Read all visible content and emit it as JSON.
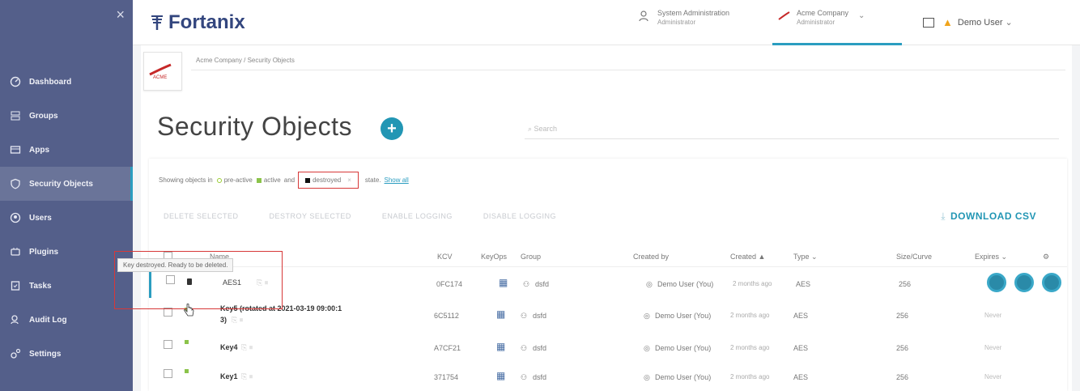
{
  "app": {
    "brand": "Fortanix"
  },
  "sidebar": {
    "close": "×",
    "items": [
      {
        "label": "Dashboard",
        "icon": "dashboard-icon"
      },
      {
        "label": "Groups",
        "icon": "groups-icon"
      },
      {
        "label": "Apps",
        "icon": "apps-icon"
      },
      {
        "label": "Security Objects",
        "icon": "security-objects-icon"
      },
      {
        "label": "Users",
        "icon": "users-icon"
      },
      {
        "label": "Plugins",
        "icon": "plugins-icon"
      },
      {
        "label": "Tasks",
        "icon": "tasks-icon"
      },
      {
        "label": "Audit Log",
        "icon": "audit-log-icon"
      },
      {
        "label": "Settings",
        "icon": "settings-icon"
      }
    ]
  },
  "header": {
    "role1": {
      "title": "System Administration",
      "sub": "Administrator"
    },
    "role2": {
      "title": "Acme Company",
      "sub": "Administrator"
    },
    "user": {
      "name": "Demo User"
    }
  },
  "main": {
    "breadcrumb": "Acme Company / Security Objects",
    "acme_logo": "ACME",
    "title": "Security Objects",
    "search_placeholder": "Search",
    "filter": {
      "prefix": "Showing objects in",
      "pre_active": "pre-active",
      "active": "active",
      "and": "and",
      "destroyed": "destroyed",
      "destroyed_x": "×",
      "state": "state.",
      "show_all": "Show all"
    },
    "actions": [
      "DELETE SELECTED",
      "DESTROY SELECTED",
      "ENABLE LOGGING",
      "DISABLE LOGGING"
    ],
    "download": "DOWNLOAD CSV",
    "columns": {
      "name": "Name",
      "kcv": "KCV",
      "keyops": "KeyOps",
      "group": "Group",
      "created_by": "Created by",
      "created": "Created ▲",
      "type": "Type ⌄",
      "size": "Size/Curve",
      "expires": "Expires ⌄",
      "settings": "⚙"
    },
    "rows": [
      {
        "name": "AES1",
        "kcv": "0FC174",
        "group": "dsfd",
        "created_by": "Demo User (You)",
        "created": "2 months ago",
        "type": "AES",
        "size": "256",
        "expires": ""
      },
      {
        "name": "Key5 (rotated at 2021-03-19 09:00:1",
        "name2": "3)",
        "kcv": "6C5112",
        "group": "dsfd",
        "created_by": "Demo User (You)",
        "created": "2 months ago",
        "type": "AES",
        "size": "256",
        "expires": "Never"
      },
      {
        "name": "Key4",
        "kcv": "A7CF21",
        "group": "dsfd",
        "created_by": "Demo User (You)",
        "created": "2 months ago",
        "type": "AES",
        "size": "256",
        "expires": "Never"
      },
      {
        "name": "Key1",
        "kcv": "371754",
        "group": "dsfd",
        "created_by": "Demo User (You)",
        "created": "2 months ago",
        "type": "AES",
        "size": "256",
        "expires": "Never"
      }
    ],
    "tooltip": "Key destroyed. Ready to be deleted."
  }
}
